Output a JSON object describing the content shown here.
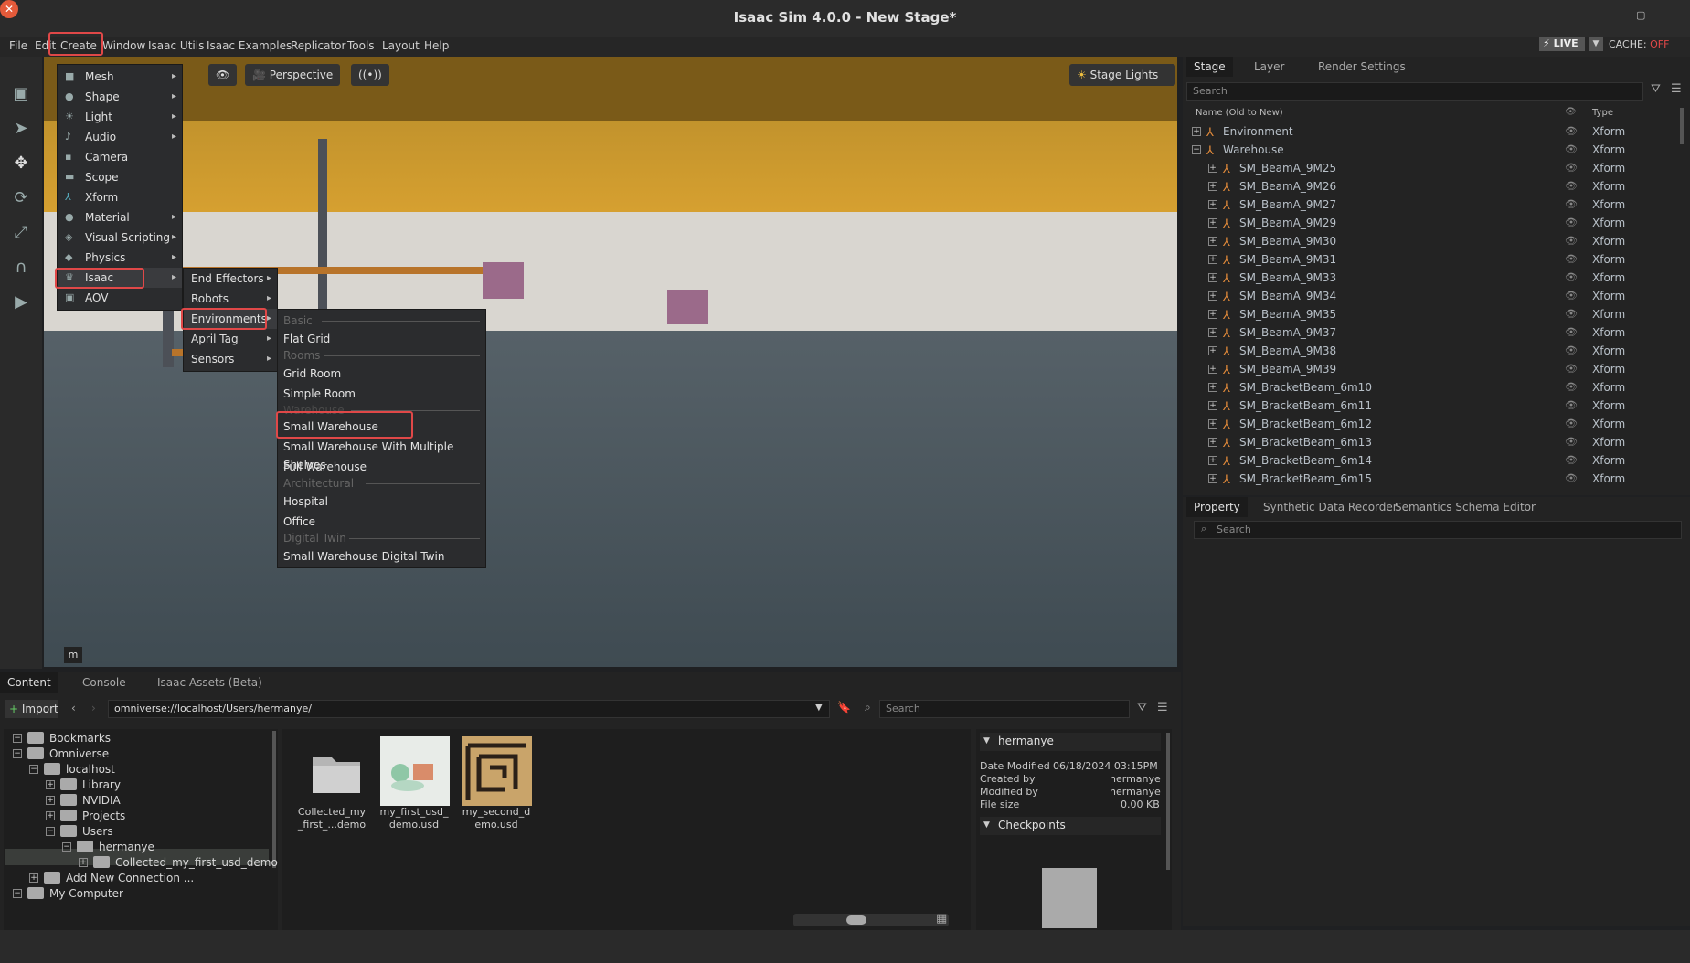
{
  "window": {
    "title": "Isaac Sim 4.0.0 - New Stage*",
    "minimize": "–",
    "restore": "▢",
    "close": "✕"
  },
  "menubar": [
    "File",
    "Edit",
    "Create",
    "Window",
    "Isaac Utils",
    "Isaac Examples",
    "Replicator",
    "Tools",
    "Layout",
    "Help"
  ],
  "status": {
    "live": "LIVE",
    "cache_label": "CACHE:",
    "cache_value": "OFF"
  },
  "viewport": {
    "camera": "Perspective",
    "lights": "Stage Lights",
    "corner": "m"
  },
  "create_menu": [
    {
      "label": "Mesh",
      "icon": "mesh-icon",
      "submenu": true
    },
    {
      "label": "Shape",
      "icon": "shape-icon",
      "submenu": true
    },
    {
      "label": "Light",
      "icon": "light-icon",
      "submenu": true
    },
    {
      "label": "Audio",
      "icon": "audio-icon",
      "submenu": true
    },
    {
      "label": "Camera",
      "icon": "camera-icon",
      "submenu": false
    },
    {
      "label": "Scope",
      "icon": "folder-icon",
      "submenu": false
    },
    {
      "label": "Xform",
      "icon": "xform-icon",
      "submenu": false
    },
    {
      "label": "Material",
      "icon": "material-icon",
      "submenu": true
    },
    {
      "label": "Visual Scripting",
      "icon": "graph-icon",
      "submenu": true
    },
    {
      "label": "Physics",
      "icon": "physics-icon",
      "submenu": true
    },
    {
      "label": "Isaac",
      "icon": "isaac-icon",
      "submenu": true
    },
    {
      "label": "AOV",
      "icon": "aov-icon",
      "submenu": false
    }
  ],
  "isaac_menu": [
    "End Effectors",
    "Robots",
    "Environments",
    "April Tag",
    "Sensors"
  ],
  "environments_menu": [
    {
      "label": "Basic",
      "section": true
    },
    {
      "label": "Flat Grid",
      "section": false
    },
    {
      "label": "Rooms",
      "section": true
    },
    {
      "label": "Grid Room",
      "section": false
    },
    {
      "label": "Simple Room",
      "section": false
    },
    {
      "label": "Warehouse",
      "section": true
    },
    {
      "label": "Small Warehouse",
      "section": false
    },
    {
      "label": "Small Warehouse With Multiple Shelves",
      "section": false
    },
    {
      "label": "Full Warehouse",
      "section": false
    },
    {
      "label": "Architectural",
      "section": true
    },
    {
      "label": "Hospital",
      "section": false
    },
    {
      "label": "Office",
      "section": false
    },
    {
      "label": "Digital Twin",
      "section": true
    },
    {
      "label": "Small Warehouse Digital Twin",
      "section": false
    }
  ],
  "stage": {
    "tabs": [
      "Stage",
      "Layer",
      "Render Settings"
    ],
    "search_placeholder": "Search",
    "col_name": "Name (Old to New)",
    "col_type": "Type",
    "rows": [
      {
        "name": "Environment",
        "type": "Xform",
        "depth": 0,
        "exp": "+"
      },
      {
        "name": "Warehouse",
        "type": "Xform",
        "depth": 0,
        "exp": "−"
      },
      {
        "name": "SM_BeamA_9M25",
        "type": "Xform",
        "depth": 1,
        "exp": "+"
      },
      {
        "name": "SM_BeamA_9M26",
        "type": "Xform",
        "depth": 1,
        "exp": "+"
      },
      {
        "name": "SM_BeamA_9M27",
        "type": "Xform",
        "depth": 1,
        "exp": "+"
      },
      {
        "name": "SM_BeamA_9M29",
        "type": "Xform",
        "depth": 1,
        "exp": "+"
      },
      {
        "name": "SM_BeamA_9M30",
        "type": "Xform",
        "depth": 1,
        "exp": "+"
      },
      {
        "name": "SM_BeamA_9M31",
        "type": "Xform",
        "depth": 1,
        "exp": "+"
      },
      {
        "name": "SM_BeamA_9M33",
        "type": "Xform",
        "depth": 1,
        "exp": "+"
      },
      {
        "name": "SM_BeamA_9M34",
        "type": "Xform",
        "depth": 1,
        "exp": "+"
      },
      {
        "name": "SM_BeamA_9M35",
        "type": "Xform",
        "depth": 1,
        "exp": "+"
      },
      {
        "name": "SM_BeamA_9M37",
        "type": "Xform",
        "depth": 1,
        "exp": "+"
      },
      {
        "name": "SM_BeamA_9M38",
        "type": "Xform",
        "depth": 1,
        "exp": "+"
      },
      {
        "name": "SM_BeamA_9M39",
        "type": "Xform",
        "depth": 1,
        "exp": "+"
      },
      {
        "name": "SM_BracketBeam_6m10",
        "type": "Xform",
        "depth": 1,
        "exp": "+"
      },
      {
        "name": "SM_BracketBeam_6m11",
        "type": "Xform",
        "depth": 1,
        "exp": "+"
      },
      {
        "name": "SM_BracketBeam_6m12",
        "type": "Xform",
        "depth": 1,
        "exp": "+"
      },
      {
        "name": "SM_BracketBeam_6m13",
        "type": "Xform",
        "depth": 1,
        "exp": "+"
      },
      {
        "name": "SM_BracketBeam_6m14",
        "type": "Xform",
        "depth": 1,
        "exp": "+"
      },
      {
        "name": "SM_BracketBeam_6m15",
        "type": "Xform",
        "depth": 1,
        "exp": "+"
      }
    ]
  },
  "property": {
    "tabs": [
      "Property",
      "Synthetic Data Recorder",
      "Semantics Schema Editor"
    ],
    "search_placeholder": "Search"
  },
  "content": {
    "tabs": [
      "Content",
      "Console",
      "Isaac Assets (Beta)"
    ],
    "import_label": "Import",
    "path": "omniverse://localhost/Users/hermanye/",
    "search_placeholder": "Search",
    "tree": [
      {
        "label": "Bookmarks",
        "depth": 0,
        "exp": "−"
      },
      {
        "label": "Omniverse",
        "depth": 0,
        "exp": "−"
      },
      {
        "label": "localhost",
        "depth": 1,
        "exp": "−"
      },
      {
        "label": "Library",
        "depth": 2,
        "exp": "+"
      },
      {
        "label": "NVIDIA",
        "depth": 2,
        "exp": "+"
      },
      {
        "label": "Projects",
        "depth": 2,
        "exp": "+"
      },
      {
        "label": "Users",
        "depth": 2,
        "exp": "−"
      },
      {
        "label": "hermanye",
        "depth": 3,
        "exp": "−"
      },
      {
        "label": "Collected_my_first_usd_demo",
        "depth": 4,
        "exp": "+"
      },
      {
        "label": "Add New Connection ...",
        "depth": 1,
        "exp": "+"
      },
      {
        "label": "My Computer",
        "depth": 0,
        "exp": "−"
      }
    ],
    "files": [
      {
        "label1": "Collected_my",
        "label2": "_first_...demo"
      },
      {
        "label1": "my_first_usd_",
        "label2": "demo.usd"
      },
      {
        "label1": "my_second_d",
        "label2": "emo.usd"
      }
    ],
    "info": {
      "folder": "hermanye",
      "date_label": "Date Modified",
      "date_value": "06/18/2024 03:15PM",
      "created_label": "Created by",
      "created_value": "hermanye",
      "modified_label": "Modified by",
      "modified_value": "hermanye",
      "size_label": "File size",
      "size_value": "0.00 KB",
      "checkpoints": "Checkpoints"
    }
  }
}
